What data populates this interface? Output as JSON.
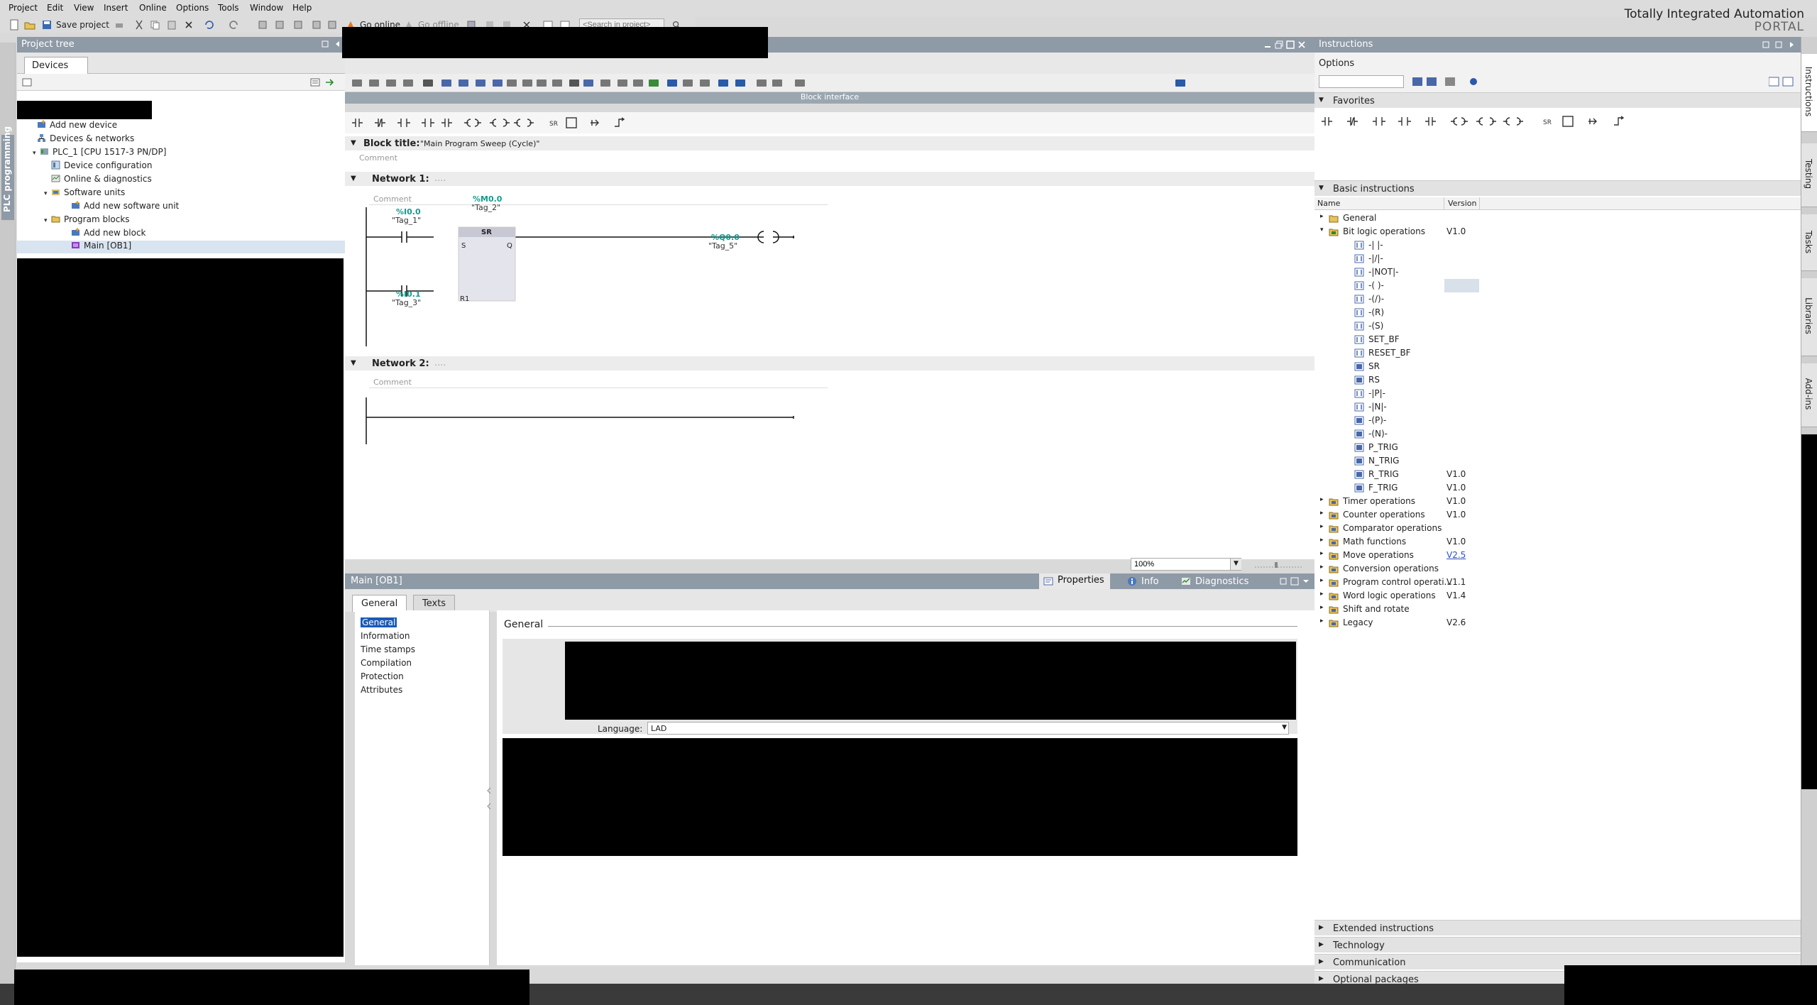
{
  "menubar": {
    "items": [
      "Project",
      "Edit",
      "View",
      "Insert",
      "Online",
      "Options",
      "Tools",
      "Window",
      "Help"
    ]
  },
  "brand": {
    "line1": "Totally Integrated Automation",
    "line2": "PORTAL"
  },
  "toolbar": {
    "save_label": "Save project",
    "go_online": "Go online",
    "go_offline": "Go offline",
    "search_placeholder": "<Search in project>"
  },
  "left_vtab": {
    "label": "PLC programming"
  },
  "project_tree": {
    "title": "Project tree",
    "tab": "Devices",
    "items": [
      {
        "label": "Add new device"
      },
      {
        "label": "Devices & networks"
      },
      {
        "label": "PLC_1 [CPU 1517-3 PN/DP]"
      },
      {
        "label": "Device configuration"
      },
      {
        "label": "Online & diagnostics"
      },
      {
        "label": "Software units"
      },
      {
        "label": "Add new software unit"
      },
      {
        "label": "Program blocks"
      },
      {
        "label": "Add new block"
      },
      {
        "label": "Main [OB1]"
      }
    ]
  },
  "editor": {
    "block_interface": "Block interface",
    "block_title_label": "Block title:",
    "block_title_value": "\"Main Program Sweep (Cycle)\"",
    "comment": "Comment",
    "network1": {
      "label": "Network 1:",
      "dots": "....",
      "contact1_addr": "%I0.0",
      "contact1_tag": "\"Tag_1\"",
      "sr_addr": "%M0.0",
      "sr_tag": "\"Tag_2\"",
      "sr_label": "SR",
      "sr_s": "S",
      "sr_q": "Q",
      "sr_r1": "R1",
      "contact2_addr": "%I0.1",
      "contact2_tag": "\"Tag_3\"",
      "coil_addr": "%Q0.0",
      "coil_tag": "\"Tag_5\""
    },
    "network2": {
      "label": "Network 2:",
      "dots": "...."
    },
    "zoom": "100%"
  },
  "properties": {
    "title": "Main [OB1]",
    "tab_properties": "Properties",
    "tab_info": "Info",
    "tab_diagnostics": "Diagnostics",
    "tab_general": "General",
    "tab_texts": "Texts",
    "nav": [
      "General",
      "Information",
      "Time stamps",
      "Compilation",
      "Protection",
      "Attributes"
    ],
    "section_title": "General",
    "language_label": "Language:",
    "language_value": "LAD"
  },
  "instructions": {
    "title": "Instructions",
    "options": "Options",
    "favorites": "Favorites",
    "basic": "Basic instructions",
    "col_name": "Name",
    "col_version": "Version",
    "rows": [
      {
        "name": "General",
        "version": "",
        "kind": "folder",
        "level": 0,
        "expand": "▸"
      },
      {
        "name": "Bit logic operations",
        "version": "V1.0",
        "kind": "folder-bit",
        "level": 0,
        "expand": "▾"
      },
      {
        "name": "-| |-",
        "version": "",
        "kind": "item",
        "level": 1
      },
      {
        "name": "-|/|-",
        "version": "",
        "kind": "item",
        "level": 1
      },
      {
        "name": "-|NOT|-",
        "version": "",
        "kind": "item",
        "level": 1
      },
      {
        "name": "-( )-",
        "version": "",
        "kind": "item",
        "level": 1
      },
      {
        "name": "-(/)-",
        "version": "",
        "kind": "item",
        "level": 1
      },
      {
        "name": "-(R)",
        "version": "",
        "kind": "item",
        "level": 1
      },
      {
        "name": "-(S)",
        "version": "",
        "kind": "item",
        "level": 1
      },
      {
        "name": "SET_BF",
        "version": "",
        "kind": "item",
        "level": 1
      },
      {
        "name": "RESET_BF",
        "version": "",
        "kind": "item",
        "level": 1
      },
      {
        "name": "SR",
        "version": "",
        "kind": "box",
        "level": 1
      },
      {
        "name": "RS",
        "version": "",
        "kind": "box",
        "level": 1
      },
      {
        "name": "-|P|-",
        "version": "",
        "kind": "item",
        "level": 1
      },
      {
        "name": "-|N|-",
        "version": "",
        "kind": "item",
        "level": 1
      },
      {
        "name": "-(P)-",
        "version": "",
        "kind": "box",
        "level": 1
      },
      {
        "name": "-(N)-",
        "version": "",
        "kind": "box",
        "level": 1
      },
      {
        "name": "P_TRIG",
        "version": "",
        "kind": "box",
        "level": 1
      },
      {
        "name": "N_TRIG",
        "version": "",
        "kind": "box",
        "level": 1
      },
      {
        "name": "R_TRIG",
        "version": "V1.0",
        "kind": "box",
        "level": 1
      },
      {
        "name": "F_TRIG",
        "version": "V1.0",
        "kind": "box",
        "level": 1
      },
      {
        "name": "Timer operations",
        "version": "V1.0",
        "kind": "folder-c",
        "level": 0,
        "expand": "▸"
      },
      {
        "name": "Counter operations",
        "version": "V1.0",
        "kind": "folder-c",
        "level": 0,
        "expand": "▸"
      },
      {
        "name": "Comparator operations",
        "version": "",
        "kind": "folder-c",
        "level": 0,
        "expand": "▸"
      },
      {
        "name": "Math functions",
        "version": "V1.0",
        "kind": "folder-c",
        "level": 0,
        "expand": "▸"
      },
      {
        "name": "Move operations",
        "version": "V2.5",
        "kind": "folder-c",
        "level": 0,
        "expand": "▸",
        "link": true
      },
      {
        "name": "Conversion operations",
        "version": "",
        "kind": "folder-c",
        "level": 0,
        "expand": "▸"
      },
      {
        "name": "Program control operati...",
        "version": "V1.1",
        "kind": "folder-c",
        "level": 0,
        "expand": "▸"
      },
      {
        "name": "Word logic operations",
        "version": "V1.4",
        "kind": "folder-c",
        "level": 0,
        "expand": "▸"
      },
      {
        "name": "Shift and rotate",
        "version": "",
        "kind": "folder-c",
        "level": 0,
        "expand": "▸"
      },
      {
        "name": "Legacy",
        "version": "V2.6",
        "kind": "folder-c",
        "level": 0,
        "expand": "▸"
      }
    ],
    "extended": "Extended instructions",
    "technology": "Technology",
    "communication": "Communication",
    "optional": "Optional packages"
  },
  "right_vtabs": [
    "Instructions",
    "Testing",
    "Tasks",
    "Libraries",
    "Add-ins"
  ],
  "colors": {
    "header_bar": "#8e9aa6",
    "tag_address": "#139c8e",
    "link": "#2a4fc4"
  }
}
